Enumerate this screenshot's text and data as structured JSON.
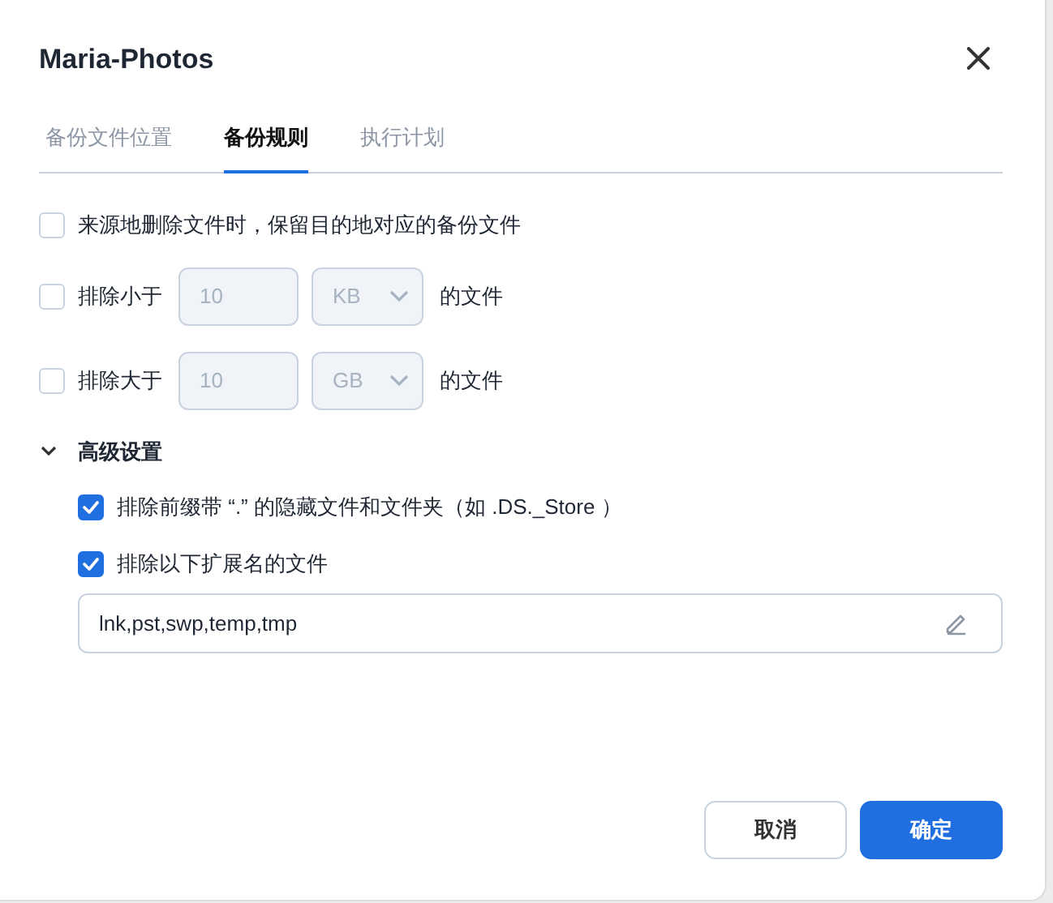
{
  "dialog": {
    "title": "Maria-Photos"
  },
  "tabs": [
    {
      "label": "备份文件位置",
      "selected": false
    },
    {
      "label": "备份规则",
      "selected": true
    },
    {
      "label": "执行计划",
      "selected": false
    }
  ],
  "rules": [
    {
      "kind": "checkbox",
      "label": "来源地删除文件时，保留目的地对应的备份文件",
      "checked": false
    },
    {
      "kind": "size",
      "label": "排除小于",
      "value": "10",
      "unit": "KB",
      "suffix": "的文件",
      "checked": false,
      "disabled": true
    },
    {
      "kind": "size",
      "label": "排除大于",
      "value": "10",
      "unit": "GB",
      "suffix": "的文件",
      "checked": false,
      "disabled": true
    }
  ],
  "advanced": {
    "label": "高级设置",
    "expanded": true,
    "options": [
      {
        "label": "排除前缀带 “.” 的隐藏文件和文件夹（如 .DS._Store ）",
        "checked": true
      },
      {
        "label": "排除以下扩展名的文件",
        "checked": true
      }
    ],
    "extensions": {
      "value": "lnk,pst,swp,temp,tmp"
    }
  },
  "buttons": [
    {
      "label": "取消",
      "kind": "secondary"
    },
    {
      "label": "确定",
      "kind": "primary"
    }
  ]
}
